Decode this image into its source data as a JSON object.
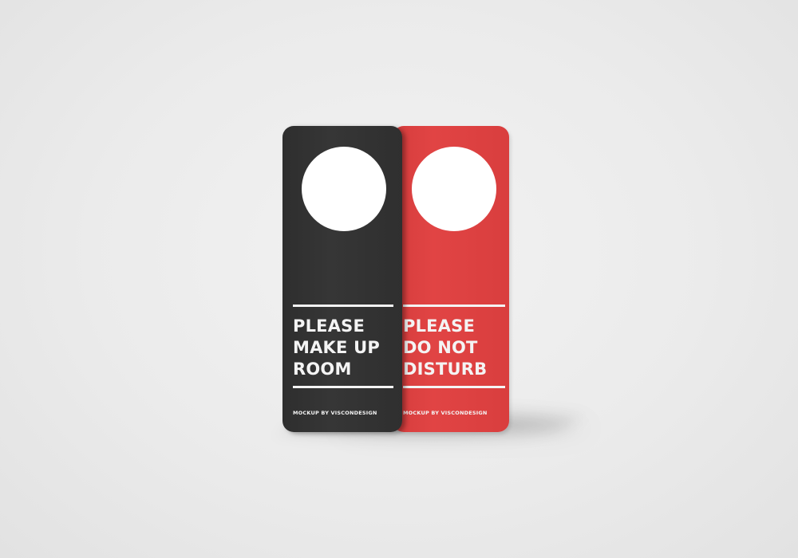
{
  "scene": {
    "background_color": "#ebebeb",
    "description_tag": "door-hanger-mockup"
  },
  "hangers": [
    {
      "color": "#333333",
      "text_lines": "PLEASE\nMAKE UP\nROOM",
      "credit": "MOCKUP BY VISCONDESIGN"
    },
    {
      "color": "#dc4040",
      "text_lines": "PLEASE\nDO NOT\nDISTURB",
      "credit": "MOCKUP BY VISCONDESIGN"
    }
  ]
}
